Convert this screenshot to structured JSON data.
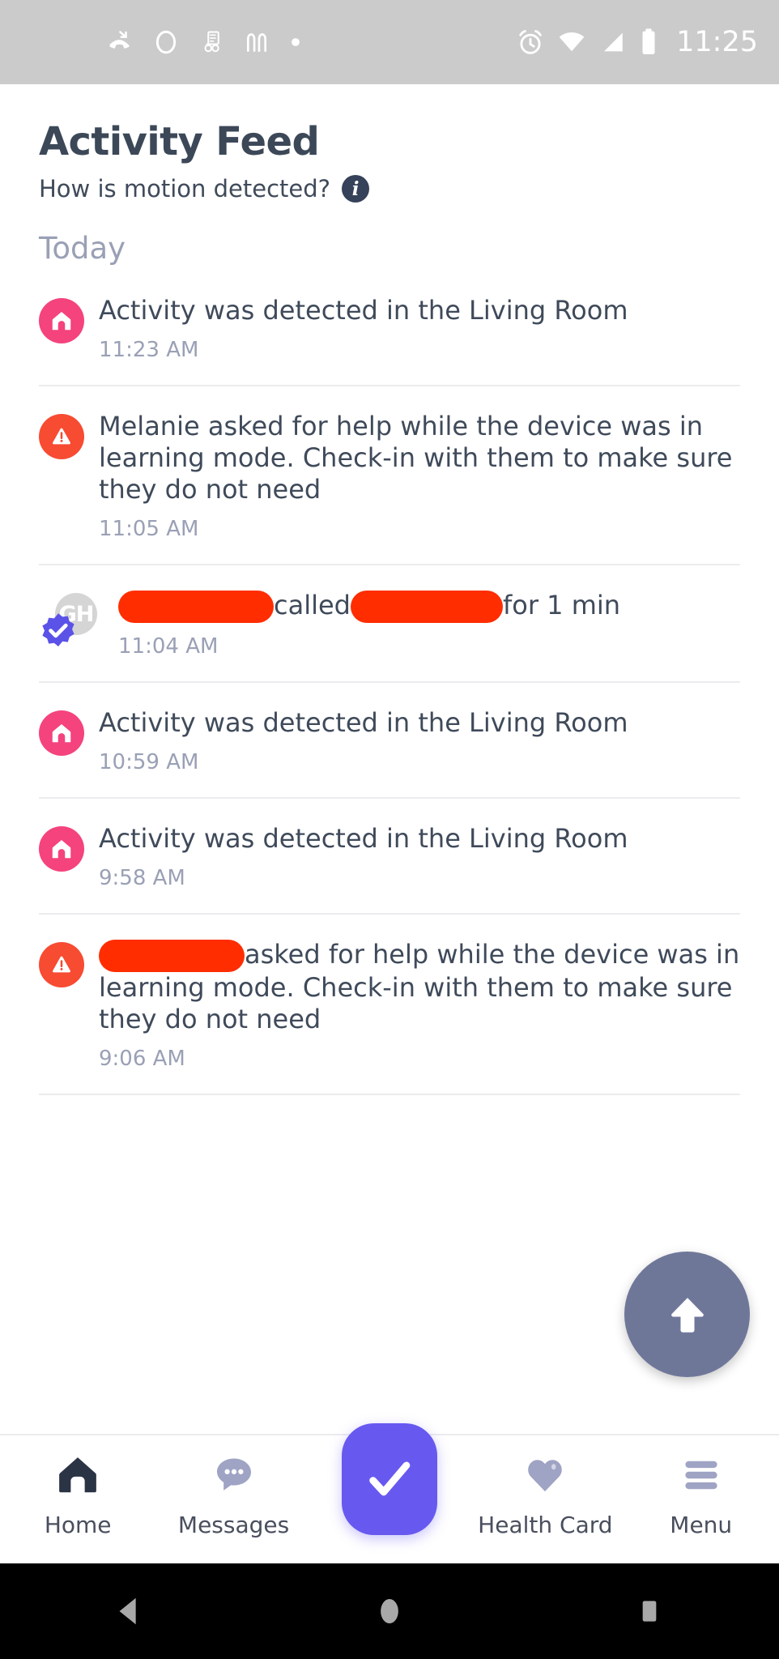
{
  "status_bar": {
    "time": "11:25",
    "left_icons": [
      "missed-call-icon",
      "ring-circle-icon",
      "device-app-icon",
      "golden-arches-icon",
      "dot-icon"
    ],
    "right_icons": [
      "alarm-icon",
      "wifi-icon",
      "cellular-signal-icon",
      "battery-icon"
    ],
    "background": "#cbcbcb"
  },
  "header": {
    "title": "Activity Feed",
    "subtitle": "How is motion detected?",
    "info_label": "i"
  },
  "feed": {
    "section_label": "Today",
    "items": [
      {
        "icon": "home-activity-icon",
        "icon_color": "#f4437d",
        "text": "Activity was detected in the Living Room",
        "time": "11:23 AM"
      },
      {
        "icon": "alert-warning-icon",
        "icon_color": "#f74b32",
        "text": "Melanie asked for help while the device was in learning mode. Check-in with them to make sure they do not need",
        "time": "11:05 AM"
      },
      {
        "icon": "verified-contact-avatar",
        "avatar_initials": "GH",
        "redacted_before": true,
        "text_middle": "called",
        "redacted_middle": true,
        "text_after": "for 1 min",
        "time": "11:04 AM"
      },
      {
        "icon": "home-activity-icon",
        "icon_color": "#f4437d",
        "text": "Activity was detected in the Living Room",
        "time": "10:59 AM"
      },
      {
        "icon": "home-activity-icon",
        "icon_color": "#f4437d",
        "text": "Activity was detected in the Living Room",
        "time": "9:58 AM"
      },
      {
        "icon": "alert-warning-icon",
        "icon_color": "#f74b32",
        "redacted_name": true,
        "text": "asked for help while the device was in learning mode. Check-in with them to make sure they do not need",
        "time": "9:06 AM"
      }
    ],
    "redaction_color": "#ff2d00"
  },
  "scroll_top_button": {
    "icon": "arrow-up-icon",
    "color": "#6f7799"
  },
  "bottom_nav": {
    "accent": "#6759f0",
    "items": [
      {
        "label": "Home",
        "icon": "house-icon",
        "active": true
      },
      {
        "label": "Messages",
        "icon": "chat-bubble-icon",
        "active": false
      },
      {
        "label": "",
        "icon": "checkmark-icon",
        "fab": true
      },
      {
        "label": "Health Card",
        "icon": "heart-icon",
        "active": false
      },
      {
        "label": "Menu",
        "icon": "hamburger-menu-icon",
        "active": false
      }
    ]
  },
  "android_nav": {
    "back": "back-triangle-icon",
    "home": "home-circle-icon",
    "recents": "recents-square-icon"
  }
}
